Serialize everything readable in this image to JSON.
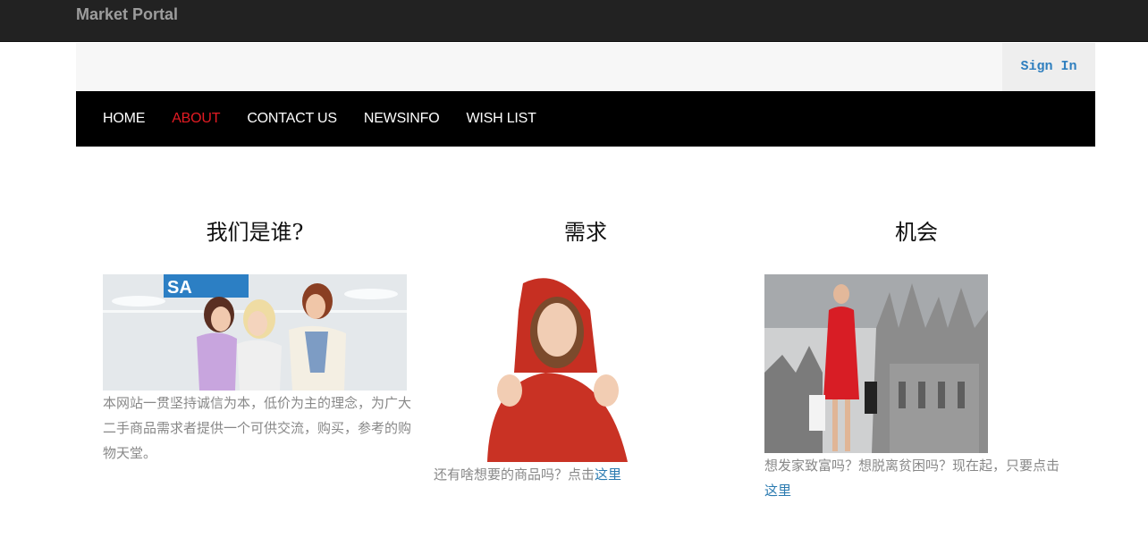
{
  "header": {
    "brand": "Market Portal"
  },
  "signbar": {
    "sign_in": "Sign In"
  },
  "nav": {
    "items": [
      {
        "label": "HOME",
        "active": false
      },
      {
        "label": "ABOUT",
        "active": true
      },
      {
        "label": "CONTACT US",
        "active": false
      },
      {
        "label": "NEWSINFO",
        "active": false
      },
      {
        "label": "WISH LIST",
        "active": false
      }
    ]
  },
  "columns": [
    {
      "title": "我们是谁?",
      "text": "本网站一贯坚持诚信为本，低价为主的理念，为广大二手商品需求者提供一个可供交流，购买，参考的购物天堂。",
      "link": ""
    },
    {
      "title": "需求",
      "text": "还有啥想要的商品吗？点击",
      "link": "这里"
    },
    {
      "title": "机会",
      "text": "想发家致富吗？想脱离贫困吗？现在起，只要点击",
      "link": "这里"
    }
  ],
  "colors": {
    "accent_active": "#e31b23",
    "link": "#2a7ab0",
    "navbar": "#000000",
    "topbar": "#222222"
  }
}
